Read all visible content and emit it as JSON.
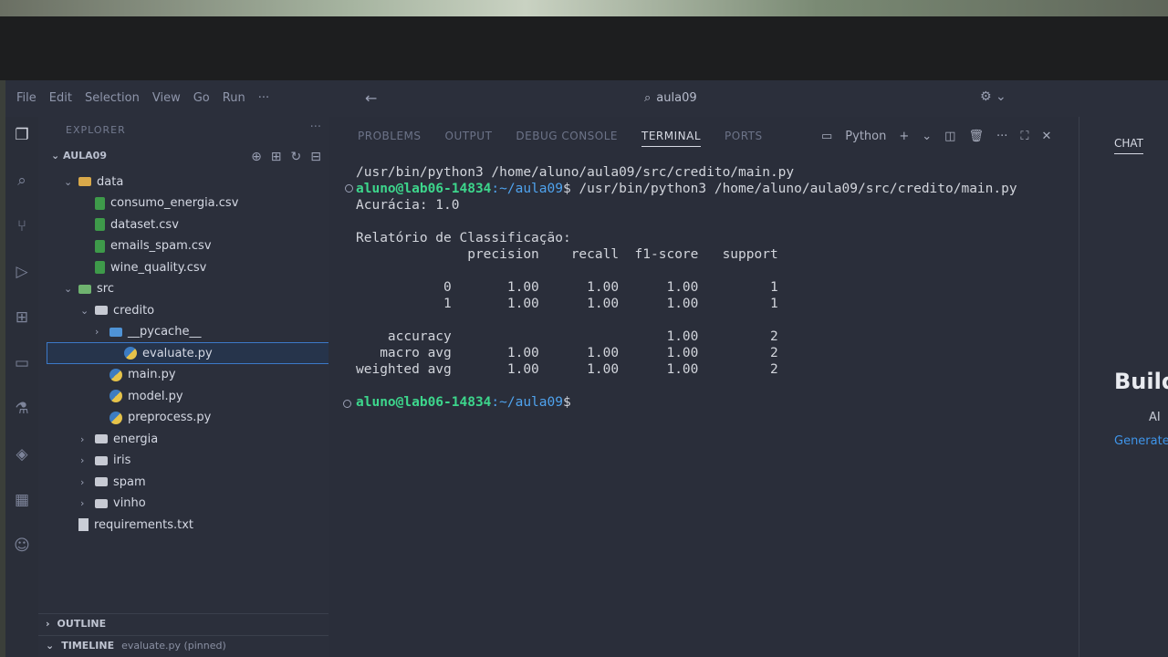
{
  "menu": [
    "File",
    "Edit",
    "Selection",
    "View",
    "Go",
    "Run",
    "···"
  ],
  "search": {
    "text": "aula09"
  },
  "sidebar": {
    "header": "EXPLORER",
    "project": "AULA09",
    "tree": [
      {
        "label": "data",
        "type": "folder-data",
        "level": 1,
        "chev": "⌄"
      },
      {
        "label": "consumo_energia.csv",
        "type": "csv",
        "level": 2
      },
      {
        "label": "dataset.csv",
        "type": "csv",
        "level": 2
      },
      {
        "label": "emails_spam.csv",
        "type": "csv",
        "level": 2
      },
      {
        "label": "wine_quality.csv",
        "type": "csv",
        "level": 2
      },
      {
        "label": "src",
        "type": "folder-src",
        "level": 1,
        "chev": "⌄"
      },
      {
        "label": "credito",
        "type": "folder",
        "level": 2,
        "chev": "⌄"
      },
      {
        "label": "__pycache__",
        "type": "folder-pyc",
        "level": 3,
        "chev": "›"
      },
      {
        "label": "evaluate.py",
        "type": "py",
        "level": 3,
        "selected": true
      },
      {
        "label": "main.py",
        "type": "py",
        "level": 3
      },
      {
        "label": "model.py",
        "type": "py",
        "level": 3
      },
      {
        "label": "preprocess.py",
        "type": "py",
        "level": 3
      },
      {
        "label": "energia",
        "type": "folder",
        "level": 2,
        "chev": "›"
      },
      {
        "label": "iris",
        "type": "folder",
        "level": 2,
        "chev": "›"
      },
      {
        "label": "spam",
        "type": "folder",
        "level": 2,
        "chev": "›"
      },
      {
        "label": "vinho",
        "type": "folder",
        "level": 2,
        "chev": "›"
      },
      {
        "label": "requirements.txt",
        "type": "txt",
        "level": 1
      }
    ],
    "outline": "OUTLINE",
    "timeline": "TIMELINE",
    "timeline_sub": "evaluate.py (pinned)"
  },
  "panel": {
    "tabs": [
      "PROBLEMS",
      "OUTPUT",
      "DEBUG CONSOLE",
      "TERMINAL",
      "PORTS"
    ],
    "active_tab": "TERMINAL",
    "shell": "Python"
  },
  "terminal": {
    "line_cmd1": "/usr/bin/python3 /home/aluno/aula09/src/credito/main.py",
    "prompt_user": "aluno@lab06-14834",
    "prompt_path": ":~/aula09",
    "line_cmd2": "$ /usr/bin/python3 /home/aluno/aula09/src/credito/main.py",
    "accuracy_line": "Acurácia: 1.0",
    "report_title": "Relatório de Classificação:",
    "report_header": "              precision    recall  f1-score   support",
    "report_rows": [
      "           0       1.00      1.00      1.00         1",
      "           1       1.00      1.00      1.00         1",
      "",
      "    accuracy                           1.00         2",
      "   macro avg       1.00      1.00      1.00         2",
      "weighted avg       1.00      1.00      1.00         2"
    ],
    "prompt_end": "$"
  },
  "chat": {
    "tab": "CHAT",
    "title": "Build",
    "subtitle": "AI",
    "link": "Generate"
  }
}
